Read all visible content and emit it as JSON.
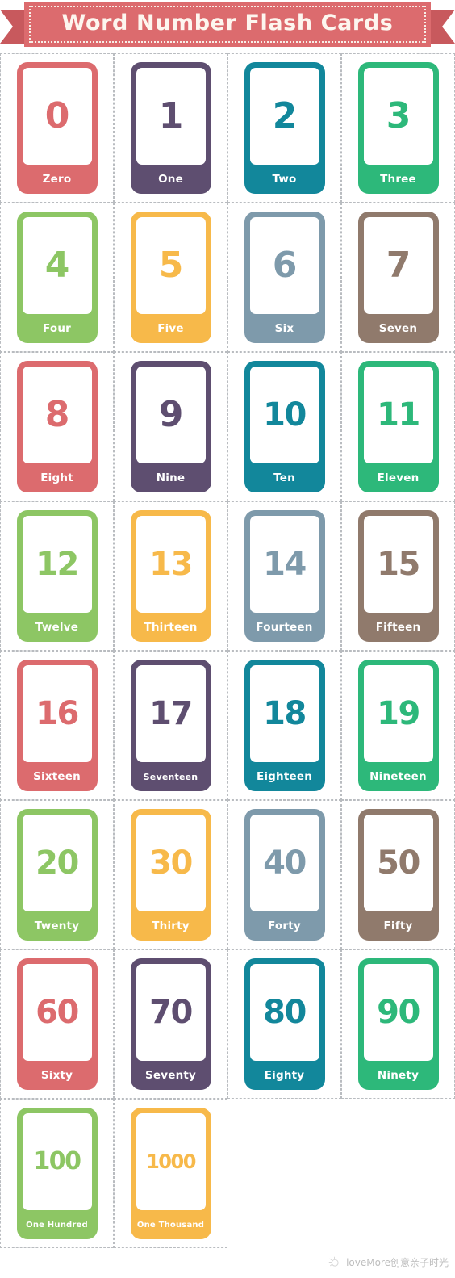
{
  "banner": {
    "title": "Word Number Flash Cards",
    "ribbon_color": "#dc6b6e",
    "ribbon_shadow_color": "#c8595d",
    "title_color": "#fdf6ef"
  },
  "palette": {
    "red": "#dc6b6e",
    "purple": "#5e4e70",
    "teal": "#12879b",
    "green": "#2db87a",
    "lightgreen": "#8dc664",
    "orange": "#f7b94a",
    "steelblue": "#7e9aab",
    "brown": "#907a6c"
  },
  "grid": {
    "columns": 4,
    "cut_line_color": "#b9bcc0"
  },
  "cards": [
    {
      "digits": "0",
      "word": "Zero",
      "color": "#dc6b6e"
    },
    {
      "digits": "1",
      "word": "One",
      "color": "#5e4e70"
    },
    {
      "digits": "2",
      "word": "Two",
      "color": "#12879b"
    },
    {
      "digits": "3",
      "word": "Three",
      "color": "#2db87a"
    },
    {
      "digits": "4",
      "word": "Four",
      "color": "#8dc664"
    },
    {
      "digits": "5",
      "word": "Five",
      "color": "#f7b94a"
    },
    {
      "digits": "6",
      "word": "Six",
      "color": "#7e9aab"
    },
    {
      "digits": "7",
      "word": "Seven",
      "color": "#907a6c"
    },
    {
      "digits": "8",
      "word": "Eight",
      "color": "#dc6b6e"
    },
    {
      "digits": "9",
      "word": "Nine",
      "color": "#5e4e70"
    },
    {
      "digits": "10",
      "word": "Ten",
      "color": "#12879b"
    },
    {
      "digits": "11",
      "word": "Eleven",
      "color": "#2db87a"
    },
    {
      "digits": "12",
      "word": "Twelve",
      "color": "#8dc664"
    },
    {
      "digits": "13",
      "word": "Thirteen",
      "color": "#f7b94a"
    },
    {
      "digits": "14",
      "word": "Fourteen",
      "color": "#7e9aab"
    },
    {
      "digits": "15",
      "word": "Fifteen",
      "color": "#907a6c"
    },
    {
      "digits": "16",
      "word": "Sixteen",
      "color": "#dc6b6e"
    },
    {
      "digits": "17",
      "word": "Seventeen",
      "color": "#5e4e70"
    },
    {
      "digits": "18",
      "word": "Eighteen",
      "color": "#12879b"
    },
    {
      "digits": "19",
      "word": "Nineteen",
      "color": "#2db87a"
    },
    {
      "digits": "20",
      "word": "Twenty",
      "color": "#8dc664"
    },
    {
      "digits": "30",
      "word": "Thirty",
      "color": "#f7b94a"
    },
    {
      "digits": "40",
      "word": "Forty",
      "color": "#7e9aab"
    },
    {
      "digits": "50",
      "word": "Fifty",
      "color": "#907a6c"
    },
    {
      "digits": "60",
      "word": "Sixty",
      "color": "#dc6b6e"
    },
    {
      "digits": "70",
      "word": "Seventy",
      "color": "#5e4e70"
    },
    {
      "digits": "80",
      "word": "Eighty",
      "color": "#12879b"
    },
    {
      "digits": "90",
      "word": "Ninety",
      "color": "#2db87a"
    },
    {
      "digits": "100",
      "word": "One Hundred",
      "color": "#8dc664"
    },
    {
      "digits": "1000",
      "word": "One Thousand",
      "color": "#f7b94a"
    }
  ],
  "watermark": {
    "text": "loveMore创意亲子时光",
    "icon": "sparkle-icon",
    "color": "#bdbdbd"
  }
}
